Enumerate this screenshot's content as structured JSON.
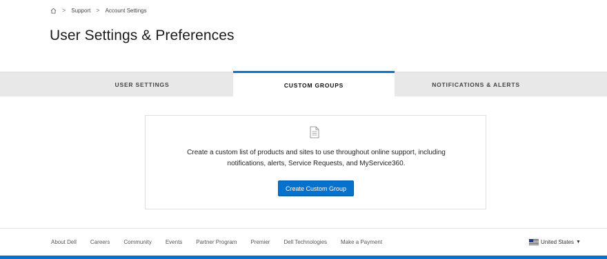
{
  "breadcrumb": {
    "items": [
      {
        "label": "Support"
      },
      {
        "label": "Account Settings"
      }
    ],
    "separator": ">"
  },
  "page": {
    "title": "User Settings & Preferences"
  },
  "tabs": [
    {
      "label": "USER SETTINGS",
      "active": false
    },
    {
      "label": "CUSTOM GROUPS",
      "active": true
    },
    {
      "label": "NOTIFICATIONS & ALERTS",
      "active": false
    }
  ],
  "custom_groups": {
    "icon": "document-icon",
    "description_line1": "Create a custom list of products and sites to use throughout online support, including",
    "description_line2": "notifications, alerts, Service Requests, and MyService360.",
    "button_label": "Create Custom Group"
  },
  "footer": {
    "links": [
      "About Dell",
      "Careers",
      "Community",
      "Events",
      "Partner Program",
      "Premier",
      "Dell Technologies",
      "Make a Payment"
    ],
    "locale": "United States",
    "locale_caret": "▼"
  },
  "colors": {
    "accent": "#0672cb",
    "tab_bar": "#e8e8e8",
    "text": "#0e0e0e"
  }
}
